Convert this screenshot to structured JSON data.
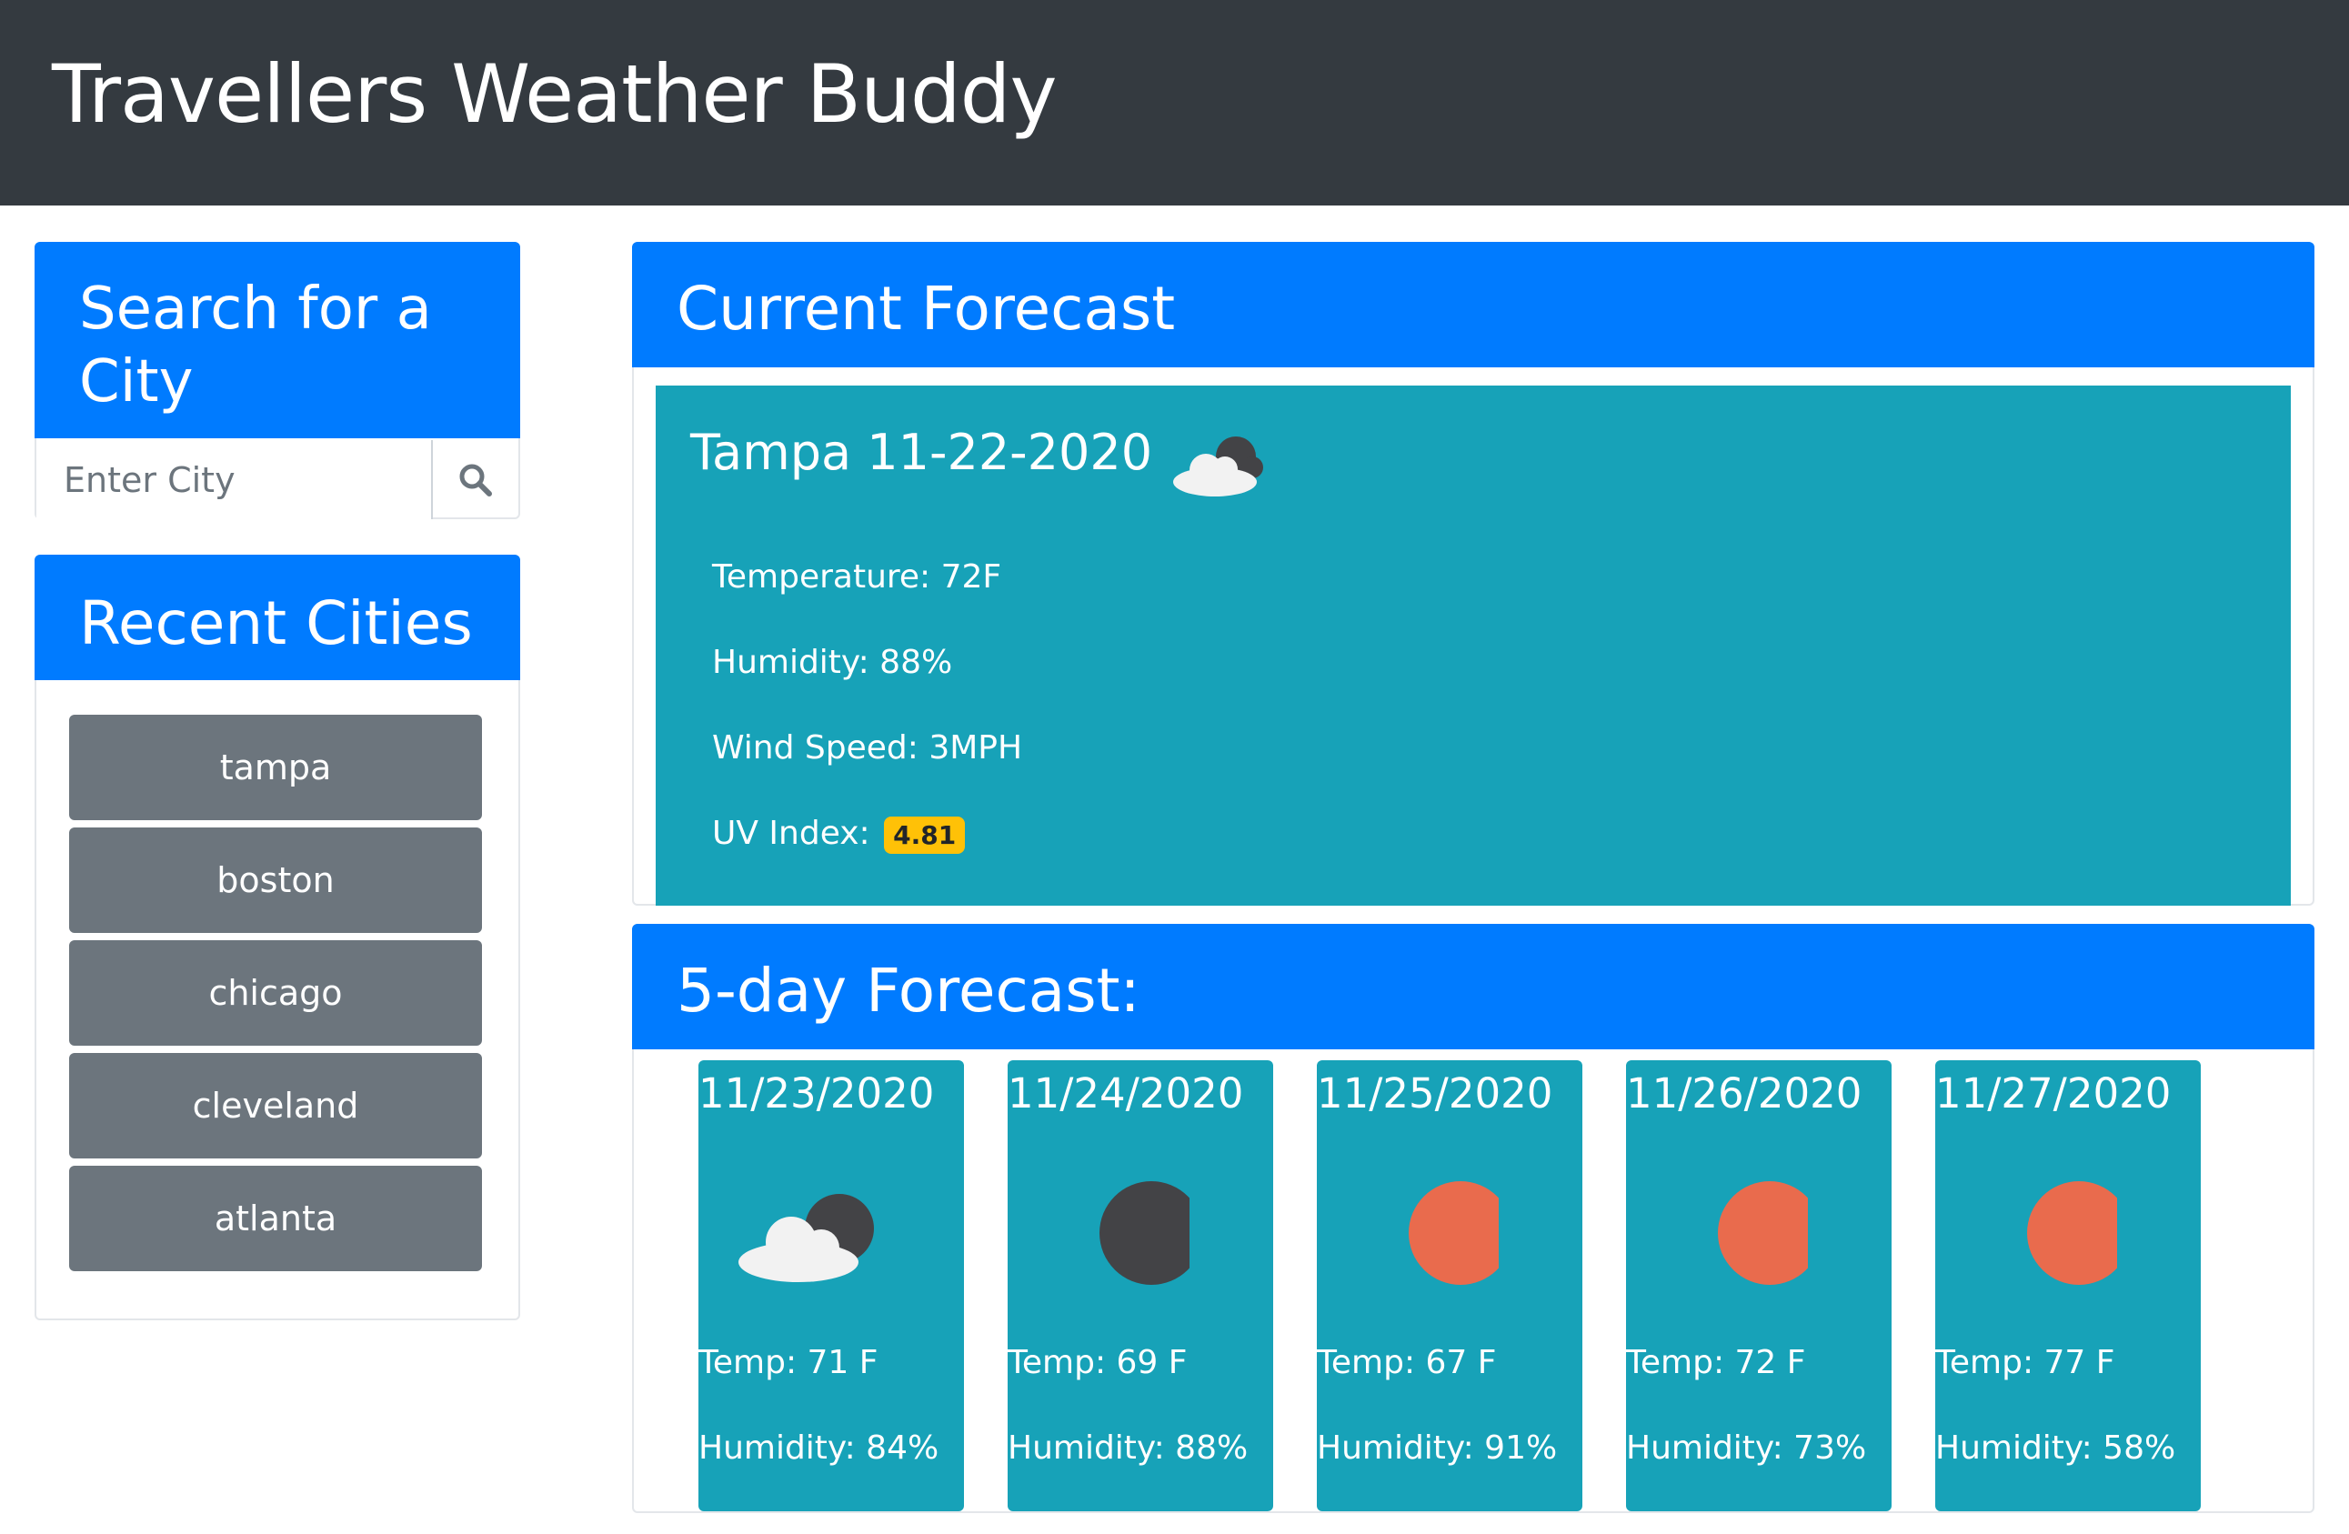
{
  "app": {
    "title": "Travellers Weather Buddy"
  },
  "search": {
    "header": "Search for a City",
    "header_line1": "Search for a",
    "header_line2": "City",
    "placeholder": "Enter City",
    "button_icon": "search-icon"
  },
  "recent": {
    "header": "Recent Cities",
    "cities": [
      "tampa",
      "boston",
      "chicago",
      "cleveland",
      "atlanta"
    ]
  },
  "current": {
    "header": "Current Forecast",
    "title": "Tampa 11-22-2020",
    "icon": "partly-cloudy-night-icon",
    "temperature": "Temperature: 72F",
    "humidity": "Humidity: 88%",
    "wind": "Wind Speed: 3MPH",
    "uv_label": "UV Index:",
    "uv_value": "4.81",
    "uv_color": "#ffc107"
  },
  "five_day": {
    "header": "5-day Forecast:",
    "days": [
      {
        "date": "11/23/2020",
        "icon": "partly-cloudy-night-icon",
        "temp": "Temp: 71 F",
        "humidity": "Humidity: 84%"
      },
      {
        "date": "11/24/2020",
        "icon": "clear-night-icon",
        "temp": "Temp: 69 F",
        "humidity": "Humidity: 88%"
      },
      {
        "date": "11/25/2020",
        "icon": "clear-day-icon",
        "temp": "Temp: 67 F",
        "humidity": "Humidity: 91%"
      },
      {
        "date": "11/26/2020",
        "icon": "clear-day-icon",
        "temp": "Temp: 72 F",
        "humidity": "Humidity: 73%"
      },
      {
        "date": "11/27/2020",
        "icon": "clear-day-icon",
        "temp": "Temp: 77 F",
        "humidity": "Humidity: 58%"
      }
    ]
  },
  "colors": {
    "navbar": "#343a40",
    "primary": "#007bff",
    "info": "#17a2b8",
    "secondary": "#6c757d",
    "sun": "#e96b4d",
    "moon": "#434346"
  }
}
